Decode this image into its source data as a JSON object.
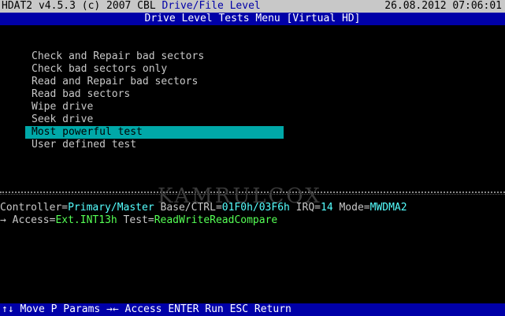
{
  "header": {
    "program": "HDAT2 v4.5.3 (c) 2007 CBL",
    "level": "Drive/File Level",
    "datetime": "26.08.2012 07:06:01"
  },
  "menu_title": "Drive Level Tests Menu [Virtual HD]",
  "menu": {
    "items": [
      {
        "label": "Check and Repair bad sectors"
      },
      {
        "label": "Check bad sectors only"
      },
      {
        "label": "Read and Repair bad sectors"
      },
      {
        "label": "Read bad sectors"
      },
      {
        "label": "Wipe drive"
      },
      {
        "label": "Seek drive"
      },
      {
        "label": "Most powerful test",
        "selected": true
      },
      {
        "label": "User defined test"
      }
    ]
  },
  "watermark": "KAMRULCOX",
  "controller": {
    "controller_key": "Controller=",
    "controller_val": "Primary/Master",
    "base_key": " Base/CTRL=",
    "base_val": "01F0h/03F6h",
    "irq_key": " IRQ=",
    "irq_val": "14",
    "mode_key": " Mode=",
    "mode_val": "MWDMA2"
  },
  "access": {
    "arrow": "→",
    "access_key": " Access=",
    "access_val": "Ext.INT13h",
    "test_key": " Test=",
    "test_val": "ReadWriteReadCompare"
  },
  "statusbar": {
    "text": "↑↓ Move P Params →← Access ENTER Run ESC Return"
  },
  "colors": {
    "menubar_bg": "#0000a8",
    "selection_bg": "#00a8a8",
    "value_cyan": "#55ffff",
    "value_green": "#55ff55"
  }
}
